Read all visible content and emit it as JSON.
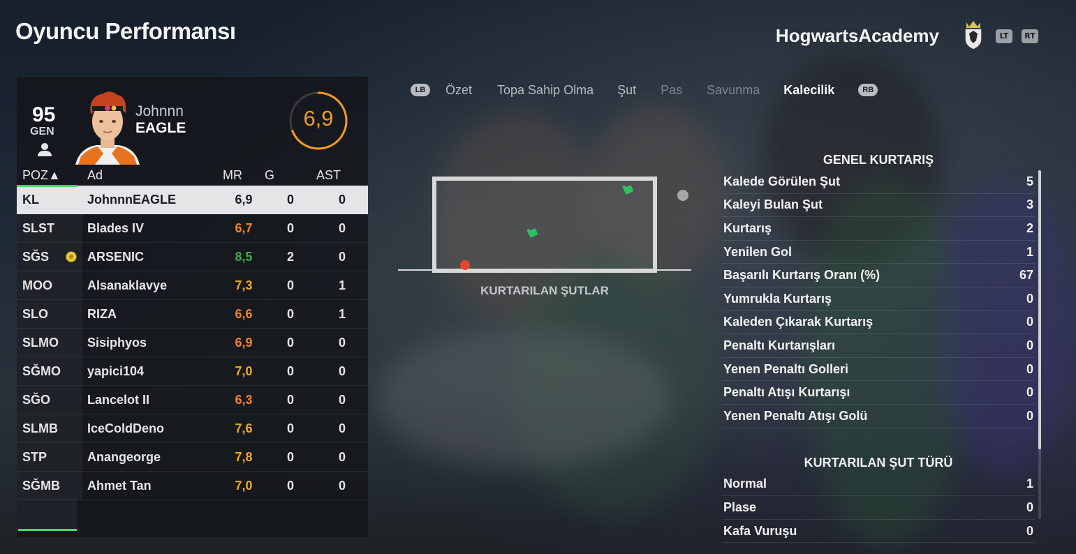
{
  "header": {
    "title": "Oyuncu Performansı",
    "team": "HogwartsAcademy",
    "lt": "LT",
    "rt": "RT"
  },
  "player": {
    "gen_value": "95",
    "gen_label": "GEN",
    "first_name": "Johnnn",
    "last_name": "EAGLE",
    "rating": "6,9",
    "rating_ring_fraction": 0.69
  },
  "tabs": {
    "lb": "LB",
    "rb": "RB",
    "items": [
      "Özet",
      "Topa Sahip Olma",
      "Şut",
      "Pas",
      "Savunma",
      "Kalecilik"
    ],
    "active": "Kalecilik"
  },
  "table": {
    "columns": {
      "pos": "POZ▲",
      "name": "Ad",
      "mr": "MR",
      "g": "G",
      "ast": "AST"
    },
    "rows": [
      {
        "pos": "KL",
        "name": "JohnnnEAGLE",
        "mr": "6,9",
        "g": "0",
        "ast": "0",
        "color": "#1a1c20"
      },
      {
        "pos": "SLST",
        "name": "Blades IV",
        "mr": "6,7",
        "g": "0",
        "ast": "0",
        "color": "#f0832a"
      },
      {
        "pos": "SĞS",
        "name": "ARSENIC",
        "mr": "8,5",
        "g": "2",
        "ast": "0",
        "color": "#3fae49"
      },
      {
        "pos": "MOO",
        "name": "Alsanaklavye",
        "mr": "7,3",
        "g": "0",
        "ast": "1",
        "color": "#f0a81f"
      },
      {
        "pos": "SLO",
        "name": "RIZA",
        "mr": "6,6",
        "g": "0",
        "ast": "1",
        "color": "#f0832a"
      },
      {
        "pos": "SLMO",
        "name": "Sisiphyos",
        "mr": "6,9",
        "g": "0",
        "ast": "0",
        "color": "#f0832a"
      },
      {
        "pos": "SĞMO",
        "name": "yapici104",
        "mr": "7,0",
        "g": "0",
        "ast": "0",
        "color": "#f0a81f"
      },
      {
        "pos": "SĞO",
        "name": "Lancelot II",
        "mr": "6,3",
        "g": "0",
        "ast": "0",
        "color": "#f0832a"
      },
      {
        "pos": "SLMB",
        "name": "IceColdDeno",
        "mr": "7,6",
        "g": "0",
        "ast": "0",
        "color": "#f0a81f"
      },
      {
        "pos": "STP",
        "name": "Anangeorge",
        "mr": "7,8",
        "g": "0",
        "ast": "0",
        "color": "#f0a81f"
      },
      {
        "pos": "SĞMB",
        "name": "Ahmet Tan",
        "mr": "7,0",
        "g": "0",
        "ast": "0",
        "color": "#f0a81f"
      }
    ]
  },
  "goal_graphic": {
    "caption": "KURTARILAN ŞUTLAR"
  },
  "stats": {
    "general_title": "GENEL KURTARIŞ",
    "general": [
      {
        "label": "Kalede Görülen Şut",
        "value": "5"
      },
      {
        "label": "Kaleyi Bulan Şut",
        "value": "3"
      },
      {
        "label": "Kurtarış",
        "value": "2"
      },
      {
        "label": "Yenilen Gol",
        "value": "1"
      },
      {
        "label": "Başarılı Kurtarış Oranı (%)",
        "value": "67"
      },
      {
        "label": "Yumrukla Kurtarış",
        "value": "0"
      },
      {
        "label": "Kaleden Çıkarak Kurtarış",
        "value": "0"
      },
      {
        "label": "Penaltı Kurtarışları",
        "value": "0"
      },
      {
        "label": "Yenen Penaltı Golleri",
        "value": "0"
      },
      {
        "label": "Penaltı Atışı Kurtarışı",
        "value": "0"
      },
      {
        "label": "Yenen Penaltı Atışı Golü",
        "value": "0"
      }
    ],
    "type_title": "KURTARILAN ŞUT TÜRÜ",
    "types": [
      {
        "label": "Normal",
        "value": "1"
      },
      {
        "label": "Plase",
        "value": "0"
      },
      {
        "label": "Kafa Vuruşu",
        "value": "0"
      }
    ]
  },
  "colors": {
    "accent_green": "#3ddc6a",
    "rating_orange": "#f39a1f"
  }
}
